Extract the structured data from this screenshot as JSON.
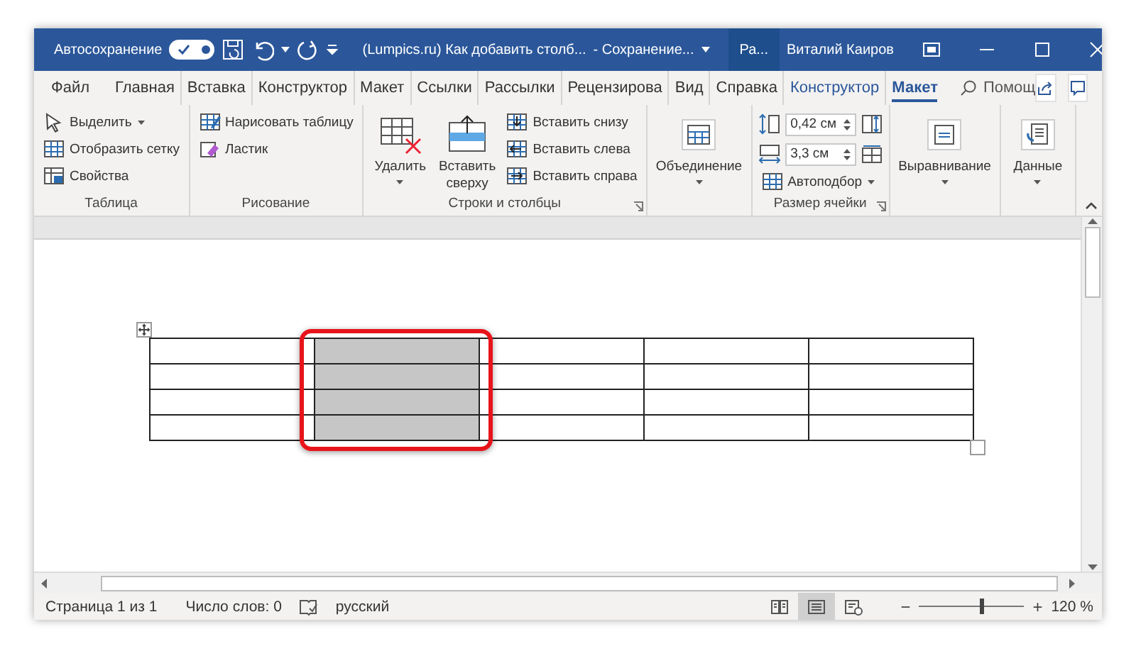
{
  "title_bar": {
    "autosave_label": "Автосохранение",
    "autosave_on": true,
    "title": "(Lumpics.ru) Как добавить столб...",
    "save_status": "- Сохранение...",
    "context_tab": "Ра...",
    "user": "Виталий Каиров"
  },
  "tabs": [
    {
      "label": "Файл",
      "kind": "standard",
      "selected": false
    },
    {
      "label": "Главная",
      "kind": "standard",
      "selected": false
    },
    {
      "label": "Вставка",
      "kind": "standard",
      "selected": false
    },
    {
      "label": "Конструктор",
      "kind": "standard",
      "selected": false
    },
    {
      "label": "Макет",
      "kind": "standard",
      "selected": false
    },
    {
      "label": "Ссылки",
      "kind": "standard",
      "selected": false
    },
    {
      "label": "Рассылки",
      "kind": "standard",
      "selected": false
    },
    {
      "label": "Рецензирова",
      "kind": "standard",
      "selected": false
    },
    {
      "label": "Вид",
      "kind": "standard",
      "selected": false
    },
    {
      "label": "Справка",
      "kind": "standard",
      "selected": false
    },
    {
      "label": "Конструктор",
      "kind": "contextual",
      "selected": false
    },
    {
      "label": "Макет",
      "kind": "contextual",
      "selected": true
    }
  ],
  "search": {
    "label": "Помощ"
  },
  "ribbon": {
    "groups": [
      {
        "label": "Таблица",
        "items": [
          {
            "kind": "small",
            "label": "Выделить",
            "dropdown": true
          },
          {
            "kind": "small",
            "label": "Отобразить сетку"
          },
          {
            "kind": "small",
            "label": "Свойства"
          }
        ]
      },
      {
        "label": "Рисование",
        "items": [
          {
            "kind": "small",
            "label": "Нарисовать таблицу"
          },
          {
            "kind": "small",
            "label": "Ластик"
          }
        ]
      },
      {
        "label": "Строки и столбцы",
        "launcher": true,
        "items": [
          {
            "kind": "large",
            "label": "Удалить",
            "dropdown": true
          },
          {
            "kind": "large",
            "label": "Вставить сверху"
          },
          {
            "kind": "small",
            "label": "Вставить снизу"
          },
          {
            "kind": "small",
            "label": "Вставить слева"
          },
          {
            "kind": "small",
            "label": "Вставить справа"
          }
        ]
      },
      {
        "items": [
          {
            "kind": "large",
            "label": "Объединение",
            "dropdown": true
          }
        ]
      },
      {
        "label": "Размер ячейки",
        "launcher": true,
        "items": [
          {
            "kind": "spin",
            "value": "0,42 см"
          },
          {
            "kind": "spin",
            "value": "3,3 см"
          },
          {
            "kind": "small",
            "label": "Автоподбор",
            "dropdown": true
          }
        ]
      },
      {
        "items": [
          {
            "kind": "large",
            "label": "Выравнивание",
            "dropdown": true
          }
        ]
      },
      {
        "items": [
          {
            "kind": "large",
            "label": "Данные",
            "dropdown": true
          }
        ]
      }
    ]
  },
  "table": {
    "rows": [
      [
        {
          "selected": false
        },
        {
          "selected": true
        },
        {
          "selected": false
        },
        {
          "selected": false
        },
        {
          "selected": false
        }
      ],
      [
        {
          "selected": false
        },
        {
          "selected": true
        },
        {
          "selected": false
        },
        {
          "selected": false
        },
        {
          "selected": false
        }
      ],
      [
        {
          "selected": false
        },
        {
          "selected": true
        },
        {
          "selected": false
        },
        {
          "selected": false
        },
        {
          "selected": false
        }
      ],
      [
        {
          "selected": false
        },
        {
          "selected": true
        },
        {
          "selected": false
        },
        {
          "selected": false
        },
        {
          "selected": false
        }
      ]
    ]
  },
  "status_bar": {
    "page": "Страница 1 из 1",
    "words": "Число слов: 0",
    "language": "русский",
    "views": [
      {
        "selected": false
      },
      {
        "selected": true
      },
      {
        "selected": false
      }
    ],
    "zoom_out": "−",
    "zoom_in": "+",
    "zoom": {
      "level": 0.6
    },
    "zoom_text": "120 %"
  }
}
